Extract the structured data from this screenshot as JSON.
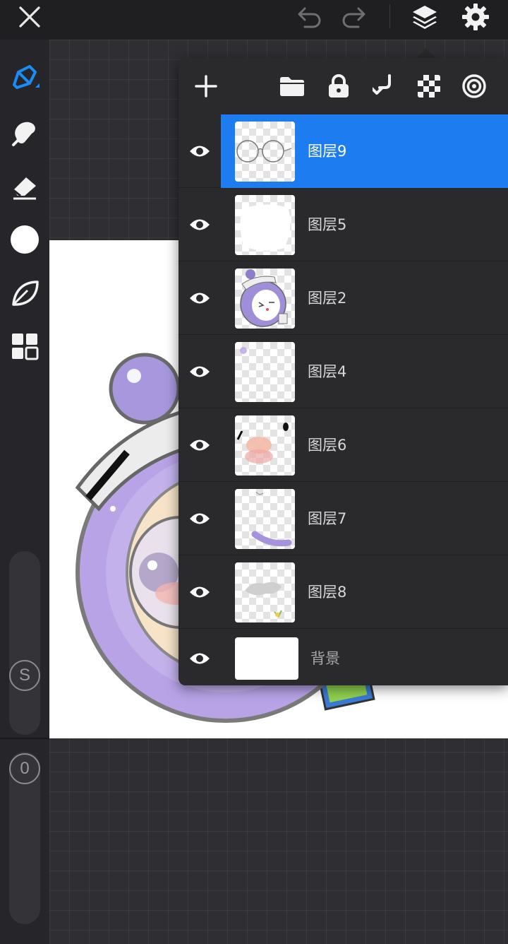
{
  "toolbar": {
    "close": "close-icon",
    "undo": "undo-icon",
    "redo": "redo-icon",
    "layers": "layers-icon",
    "settings": "gear-icon"
  },
  "left_tools": [
    "brush-icon",
    "smudge-icon",
    "eraser-icon",
    "color-swatch",
    "leaf-icon",
    "gallery-icon"
  ],
  "sliders": {
    "size_label": "S",
    "opacity_label": "0"
  },
  "layers_panel": {
    "actions": [
      "add-icon",
      "folder-icon",
      "lock-icon",
      "merge-down-icon",
      "checker-icon",
      "target-icon"
    ],
    "layers": [
      {
        "name": "图层9",
        "visible": true,
        "active": true
      },
      {
        "name": "图层5",
        "visible": true,
        "active": false
      },
      {
        "name": "图层2",
        "visible": true,
        "active": false
      },
      {
        "name": "图层4",
        "visible": true,
        "active": false
      },
      {
        "name": "图层6",
        "visible": true,
        "active": false
      },
      {
        "name": "图层7",
        "visible": true,
        "active": false
      },
      {
        "name": "图层8",
        "visible": true,
        "active": false
      }
    ],
    "background": {
      "name": "背景",
      "visible": true
    }
  },
  "colors": {
    "accent": "#1c7cf0",
    "panel": "#2a2a2c",
    "toolbar": "#1f1f22",
    "character": "#b7a3e6"
  }
}
